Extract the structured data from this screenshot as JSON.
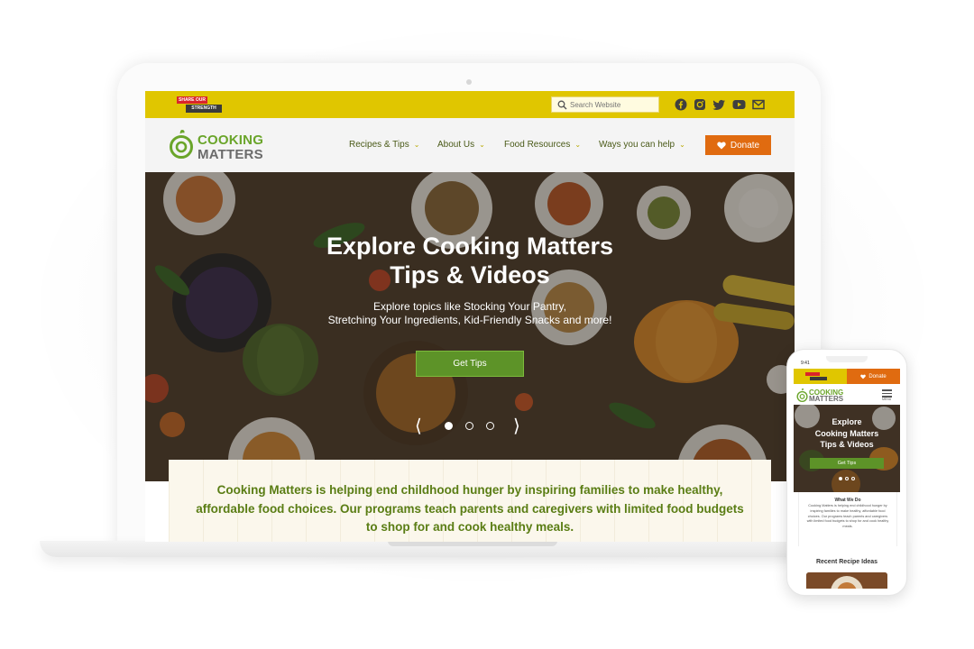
{
  "desktop": {
    "topbar": {
      "partner_logo_top": "SHARE OUR",
      "partner_logo_bottom": "STRENGTH",
      "search_placeholder": "Search Website",
      "social_icons": [
        "facebook-icon",
        "instagram-icon",
        "twitter-icon",
        "youtube-icon",
        "email-icon"
      ]
    },
    "nav": {
      "logo_line1": "COOKING",
      "logo_line2": "MATTERS",
      "items": [
        {
          "label": "Recipes & Tips"
        },
        {
          "label": "About Us"
        },
        {
          "label": "Food Resources"
        },
        {
          "label": "Ways you can help"
        }
      ],
      "donate_label": "Donate"
    },
    "hero": {
      "title_line1": "Explore Cooking Matters",
      "title_line2": "Tips & Videos",
      "subtitle_line1": "Explore topics like Stocking Your Pantry,",
      "subtitle_line2": "Stretching Your Ingredients, Kid-Friendly Snacks and more!",
      "cta_label": "Get Tips",
      "slides_total": 3,
      "active_slide": 1
    },
    "mission": {
      "text": "Cooking Matters is helping end childhood hunger by inspiring families to make healthy, affordable food choices. Our programs teach parents and caregivers with limited food budgets to shop for and cook healthy meals."
    }
  },
  "mobile": {
    "time": "9:41",
    "donate_label": "Donate",
    "logo_line1": "COOKING",
    "logo_line2": "MATTERS",
    "menu_label": "MENU",
    "hero_title_line1": "Explore",
    "hero_title_line2": "Cooking Matters",
    "hero_title_line3": "Tips & Videos",
    "cta_label": "Get Tips",
    "card_title": "What We Do",
    "card_body": "Cooking Matters is helping end childhood hunger by inspiring families to make healthy, affordable food choices. Our programs teach parents and caregivers with limited food budgets to shop for and cook healthy meals.",
    "recent_title": "Recent Recipe Ideas"
  },
  "colors": {
    "brand_yellow": "#e0c600",
    "brand_green": "#6aa52a",
    "donate_orange": "#e06b10",
    "cta_green": "#5d9328",
    "mission_text": "#5a7d14"
  }
}
